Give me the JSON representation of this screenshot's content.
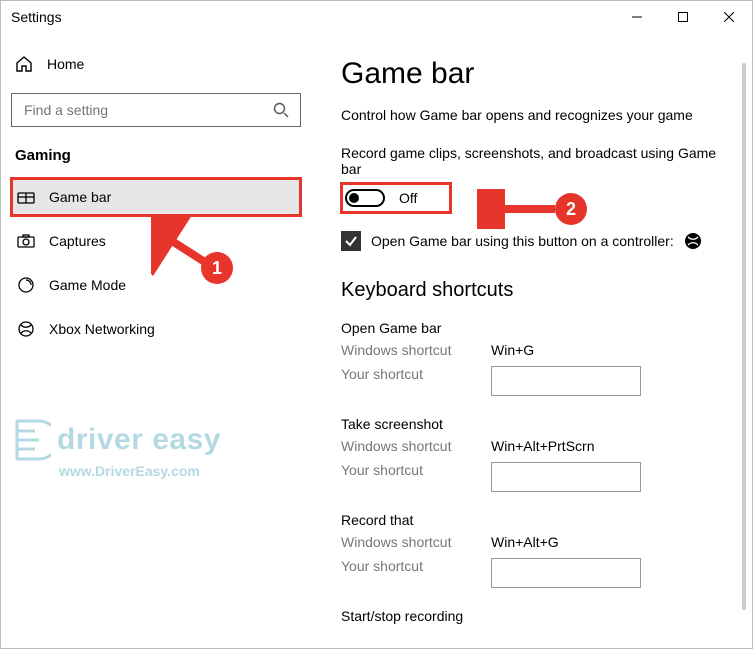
{
  "window": {
    "title": "Settings"
  },
  "sidebar": {
    "home": "Home",
    "search_placeholder": "Find a setting",
    "section": "Gaming",
    "items": [
      {
        "label": "Game bar"
      },
      {
        "label": "Captures"
      },
      {
        "label": "Game Mode"
      },
      {
        "label": "Xbox Networking"
      }
    ]
  },
  "page": {
    "title": "Game bar",
    "desc": "Control how Game bar opens and recognizes your game",
    "record_desc": "Record game clips, screenshots, and broadcast using Game bar",
    "toggle_state": "Off",
    "checkbox_label": "Open Game bar using this button on a controller:",
    "shortcuts_heading": "Keyboard shortcuts",
    "groups": [
      {
        "title": "Open Game bar",
        "win_label": "Windows shortcut",
        "win_value": "Win+G",
        "your_label": "Your shortcut"
      },
      {
        "title": "Take screenshot",
        "win_label": "Windows shortcut",
        "win_value": "Win+Alt+PrtScrn",
        "your_label": "Your shortcut"
      },
      {
        "title": "Record that",
        "win_label": "Windows shortcut",
        "win_value": "Win+Alt+G",
        "your_label": "Your shortcut"
      },
      {
        "title": "Start/stop recording",
        "win_label": "",
        "win_value": "",
        "your_label": ""
      }
    ]
  },
  "annotations": {
    "num1": "1",
    "num2": "2"
  },
  "watermark": {
    "line1": "driver easy",
    "line2": "www.DriverEasy.com"
  }
}
